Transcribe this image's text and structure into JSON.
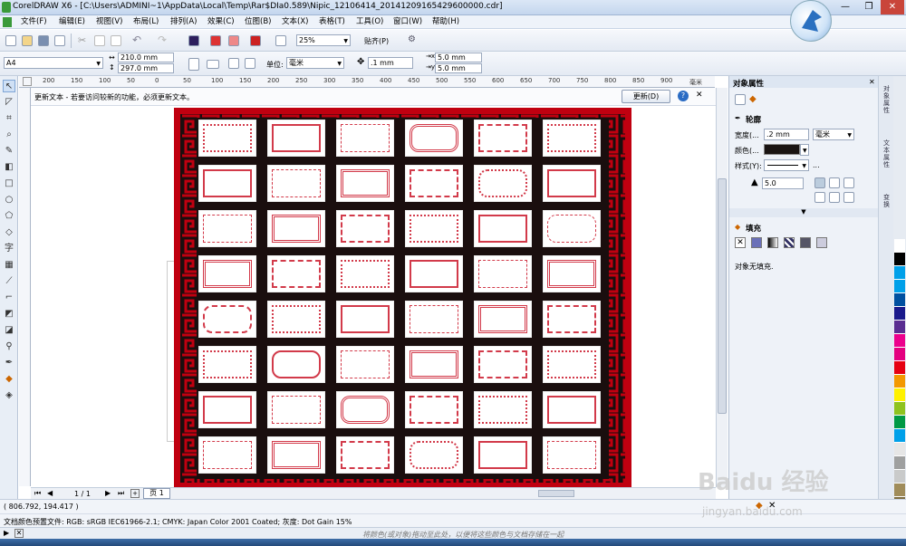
{
  "window": {
    "title": "CorelDRAW X6 - [C:\\Users\\ADMINI~1\\AppData\\Local\\Temp\\Rar$DIa0.589\\Nipic_12106414_20141209165429600000.cdr]",
    "minimize": "—",
    "restore": "❐",
    "close": "✕"
  },
  "menu": [
    "文件(F)",
    "编辑(E)",
    "视图(V)",
    "布局(L)",
    "排列(A)",
    "效果(C)",
    "位图(B)",
    "文本(X)",
    "表格(T)",
    "工具(O)",
    "窗口(W)",
    "帮助(H)"
  ],
  "toolbar": {
    "zoom": "25%",
    "snap": "贴齐(P)"
  },
  "propbar": {
    "page_size": "A4",
    "width": "210.0 mm",
    "height": "297.0 mm",
    "units_label": "单位:",
    "units": "毫米",
    "nudge": ".1 mm",
    "dup_x": "5.0 mm",
    "dup_y": "5.0 mm"
  },
  "ruler": {
    "marks": [
      "200",
      "150",
      "100",
      "50",
      "0",
      "50",
      "100",
      "150",
      "200",
      "250",
      "300",
      "350",
      "400",
      "450",
      "500",
      "550",
      "600",
      "650",
      "700",
      "750",
      "800",
      "850",
      "900"
    ],
    "unit": "毫米"
  },
  "notice": {
    "text": "更新文本 - 若要访问较新的功能，必须更新文本。",
    "button": "更新(D)"
  },
  "docker": {
    "title": "对象属性",
    "outline_title": "轮廓",
    "width_label": "宽度(...",
    "width_value": ".2 mm",
    "width_unit": "毫米",
    "color_label": "颜色(...",
    "style_label": "样式(Y):",
    "miter_value": "5.0",
    "fill_title": "填充",
    "fill_status": "对象无填充.",
    "more": "..."
  },
  "sidetabs": [
    "对象属性",
    "文本属性",
    "变换"
  ],
  "palette_colors": [
    "#ffffff",
    "#000000",
    "#00a0e9",
    "#00a0e9",
    "#0050a0",
    "#1a1a8c",
    "#5a2d91",
    "#ec008c",
    "#e4007f",
    "#e60012",
    "#f39800",
    "#fff100",
    "#8fc31f",
    "#009944",
    "#00a0e9",
    "#e6e6e6",
    "#9fa0a0",
    "#c9caca",
    "#a08c5a",
    "#7d6c40"
  ],
  "pages": {
    "counter": "1 / 1",
    "tab": "页 1"
  },
  "status": {
    "coords": "( 806.792, 194.417 )",
    "color_profile": "文档颜色预置文件: RGB: sRGB IEC61966-2.1; CMYK: Japan Color 2001 Coated; 灰度: Dot Gain 15%",
    "hint": "将颜色(或对象)拖动至此处，以便将这些颜色与文档存储在一起"
  },
  "watermark": {
    "brand": "Baidu 经验",
    "url": "jingyan.baidu.com"
  },
  "accent": {
    "board_bg": "#1a0e0e",
    "board_border": "#c00010",
    "frame_red": "#d23a4a"
  }
}
